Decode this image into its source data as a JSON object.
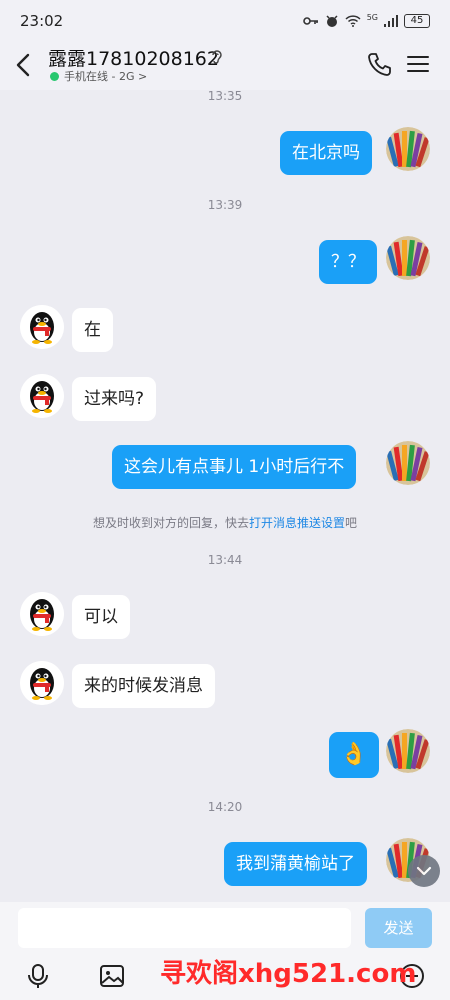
{
  "status_bar": {
    "time": "23:02",
    "network": "5G",
    "battery": "45"
  },
  "header": {
    "contact_name": "露露17810208162",
    "online_status": "手机在线 - 2G",
    "chevron": ">"
  },
  "messages": [
    {
      "type": "timestamp",
      "text": "13:35"
    },
    {
      "type": "me",
      "text": "在北京吗"
    },
    {
      "type": "timestamp",
      "text": "13:39"
    },
    {
      "type": "me",
      "text": "？？"
    },
    {
      "type": "other",
      "text": "在"
    },
    {
      "type": "other",
      "text": "过来吗?"
    },
    {
      "type": "me",
      "text": "这会儿有点事儿 1小时后行不"
    },
    {
      "type": "notice",
      "text": "想及时收到对方的回复，快去",
      "link": "打开消息推送设置",
      "suffix": "吧"
    },
    {
      "type": "timestamp",
      "text": "13:44"
    },
    {
      "type": "other",
      "text": "可以"
    },
    {
      "type": "other",
      "text": "来的时候发消息"
    },
    {
      "type": "me",
      "text": "👌"
    },
    {
      "type": "timestamp",
      "text": "14:20"
    },
    {
      "type": "me",
      "text": "我到蒲黄榆站了"
    }
  ],
  "input": {
    "placeholder": "",
    "send_label": "发送"
  },
  "watermark": "寻欢阁xhg521.com",
  "colors": {
    "bubble_me": "#1aa0f7",
    "online": "#28c76f",
    "send_button": "#8fcbf5",
    "link": "#1e88e5"
  }
}
